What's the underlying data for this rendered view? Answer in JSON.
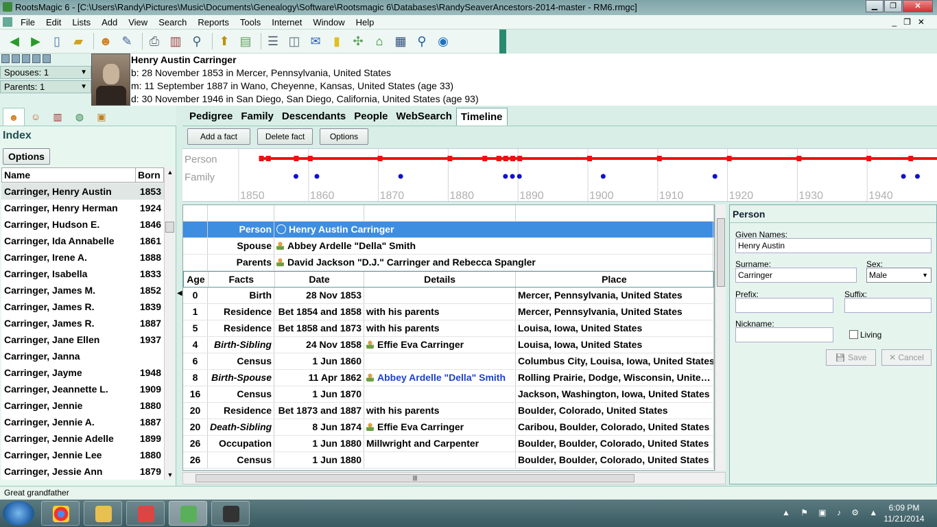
{
  "window": {
    "title": "RootsMagic 6 - [C:\\Users\\Randy\\Pictures\\Music\\Documents\\Genealogy\\Software\\Rootsmagic 6\\Databases\\RandySeaverAncestors-2014-master - RM6.rmgc]"
  },
  "menu": [
    "File",
    "Edit",
    "Lists",
    "Add",
    "View",
    "Search",
    "Reports",
    "Tools",
    "Internet",
    "Window",
    "Help"
  ],
  "toolbar_icons": [
    "back-arrow-icon",
    "forward-arrow-icon",
    "new-file-icon",
    "open-folder-icon",
    "add-person-icon",
    "edit-person-icon",
    "print-icon",
    "books-icon",
    "search-icon",
    "navigate-icon",
    "notes-icon",
    "report-icon",
    "media-icon",
    "email-icon",
    "sticky-note-icon",
    "tree-icon",
    "home-icon",
    "book-icon",
    "magnify-icon",
    "web-icon"
  ],
  "left": {
    "spouses": "Spouses: 1",
    "parents": "Parents: 1"
  },
  "person": {
    "name": "Henry Austin Carringer",
    "birth": "b: 28 November 1853 in Mercer, Pennsylvania, United States",
    "marriage": "m: 11 September 1887 in Wano, Cheyenne, Kansas, United States (age 33)",
    "death": "d: 30 November 1946 in San Diego, San Diego, California, United States (age 93)"
  },
  "index": {
    "title": "Index",
    "options_label": "Options",
    "col_name": "Name",
    "col_born": "Born",
    "rows": [
      {
        "name": "Carringer, Henry Austin",
        "born": "1853"
      },
      {
        "name": "Carringer, Henry Herman",
        "born": "1924"
      },
      {
        "name": "Carringer, Hudson E.",
        "born": "1846"
      },
      {
        "name": "Carringer, Ida Annabelle",
        "born": "1861"
      },
      {
        "name": "Carringer, Irene A.",
        "born": "1888"
      },
      {
        "name": "Carringer, Isabella",
        "born": "1833"
      },
      {
        "name": "Carringer, James M.",
        "born": "1852"
      },
      {
        "name": "Carringer, James R.",
        "born": "1839"
      },
      {
        "name": "Carringer, James R.",
        "born": "1887"
      },
      {
        "name": "Carringer, Jane Ellen",
        "born": "1937"
      },
      {
        "name": "Carringer, Janna",
        "born": ""
      },
      {
        "name": "Carringer, Jayme",
        "born": "1948"
      },
      {
        "name": "Carringer, Jeannette L.",
        "born": "1909"
      },
      {
        "name": "Carringer, Jennie",
        "born": "1880"
      },
      {
        "name": "Carringer, Jennie A.",
        "born": "1887"
      },
      {
        "name": "Carringer, Jennie Adelle",
        "born": "1899"
      },
      {
        "name": "Carringer, Jennie Lee",
        "born": "1880"
      },
      {
        "name": "Carringer, Jessie Ann",
        "born": "1879"
      }
    ]
  },
  "view_tabs": [
    "Pedigree",
    "Family",
    "Descendants",
    "People",
    "WebSearch",
    "Timeline"
  ],
  "actions": {
    "add": "Add a fact",
    "delete": "Delete fact",
    "options": "Options"
  },
  "timeline": {
    "row_person": "Person",
    "row_family": "Family",
    "years": [
      "1850",
      "1860",
      "1870",
      "1880",
      "1890",
      "1900",
      "1910",
      "1920",
      "1930",
      "1940"
    ],
    "person_span": [
      1853,
      1954
    ],
    "person_events": [
      1853,
      1854,
      1858,
      1860,
      1870,
      1880,
      1885,
      1887,
      1888,
      1889,
      1890,
      1900,
      1910,
      1920,
      1930,
      1940,
      1946
    ],
    "family_events": [
      1858,
      1861,
      1873,
      1888,
      1889,
      1890,
      1902,
      1918,
      1945,
      1947
    ],
    "color_person": "#ee1111",
    "color_family": "#1111cc"
  },
  "grid": {
    "header": {
      "age": "Age",
      "fact": "Facts",
      "date": "Date",
      "details": "Details",
      "place": "Place"
    },
    "top": [
      {
        "label": "Person",
        "value": "Henry Austin Carringer"
      },
      {
        "label": "Spouse",
        "value": "Abbey Ardelle \"Della\" Smith"
      },
      {
        "label": "Parents",
        "value": "David Jackson \"D.J.\" Carringer and Rebecca Spangler"
      }
    ],
    "rows": [
      {
        "age": "0",
        "fact": "Birth",
        "date": "28 Nov 1853",
        "details": "",
        "place": "Mercer, Pennsylvania, United States"
      },
      {
        "age": "1",
        "fact": "Residence",
        "date": "Bet 1854 and 1858",
        "details": "with his parents",
        "place": "Mercer, Pennsylvania, United States"
      },
      {
        "age": "5",
        "fact": "Residence",
        "date": "Bet 1858 and 1873",
        "details": "with his parents",
        "place": "Louisa, Iowa, United States"
      },
      {
        "age": "4",
        "fact": "Birth-Sibling",
        "date": "24 Nov 1858",
        "details": "Effie Eva Carringer",
        "place": "Louisa, Iowa, United States"
      },
      {
        "age": "6",
        "fact": "Census",
        "date": "1 Jun 1860",
        "details": "",
        "place": "Columbus City, Louisa, Iowa, United States"
      },
      {
        "age": "8",
        "fact": "Birth-Spouse",
        "date": "11 Apr 1862",
        "details": "Abbey Ardelle \"Della\" Smith",
        "place": "Rolling Prairie, Dodge, Wisconsin, Unite…"
      },
      {
        "age": "16",
        "fact": "Census",
        "date": "1 Jun 1870",
        "details": "",
        "place": "Jackson, Washington, Iowa, United States"
      },
      {
        "age": "20",
        "fact": "Residence",
        "date": "Bet 1873 and 1887",
        "details": "with his parents",
        "place": "Boulder, Colorado, United States"
      },
      {
        "age": "20",
        "fact": "Death-Sibling",
        "date": "8 Jun 1874",
        "details": "Effie Eva Carringer",
        "place": "Caribou, Boulder, Colorado, United States"
      },
      {
        "age": "26",
        "fact": "Occupation",
        "date": "1 Jun 1880",
        "details": "Millwright and Carpenter",
        "place": "Boulder, Boulder, Colorado, United States"
      },
      {
        "age": "26",
        "fact": "Census",
        "date": "1 Jun 1880",
        "details": "",
        "place": "Boulder, Boulder, Colorado, United States"
      }
    ]
  },
  "panel": {
    "title": "Person",
    "given_label": "Given Names:",
    "given": "Henry Austin",
    "surname_label": "Surname:",
    "surname": "Carringer",
    "sex_label": "Sex:",
    "sex": "Male",
    "prefix_label": "Prefix:",
    "suffix_label": "Suffix:",
    "nickname_label": "Nickname:",
    "living_label": "Living",
    "save": "Save",
    "cancel": "Cancel"
  },
  "status": "Great grandfather",
  "clock": {
    "time": "6:09 PM",
    "date": "11/21/2014"
  }
}
